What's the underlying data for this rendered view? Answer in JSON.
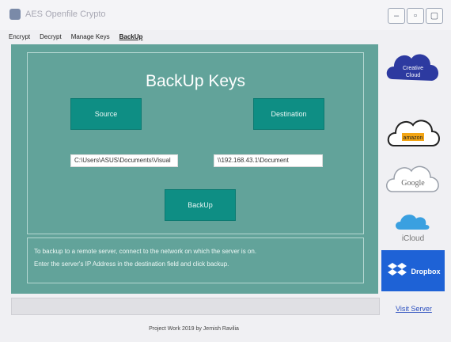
{
  "window": {
    "title": "AES Openfile Crypto"
  },
  "menu": {
    "tabs": [
      {
        "label": "Encrypt"
      },
      {
        "label": "Decrypt"
      },
      {
        "label": "Manage Keys"
      },
      {
        "label": "BackUp"
      }
    ],
    "active_tab": "BackUp"
  },
  "backup": {
    "heading": "BackUp Keys",
    "source_button": "Source",
    "destination_button": "Destination",
    "source_path": "C:\\Users\\ASUS\\Documents\\Visual",
    "destination_path": "\\\\192.168.43.1\\Document",
    "backup_button": "BackUp"
  },
  "info": {
    "line1": "To backup to a remote server, connect to the network on which the server is on.",
    "line2": "Enter the server's IP Address in the destination field and click backup."
  },
  "sidebar": {
    "logos": [
      {
        "label1": "Creative",
        "label2": "Cloud",
        "icon": "creative-cloud-icon"
      },
      {
        "label1": "amazon",
        "icon": "amazon-cloud-icon"
      },
      {
        "label1": "Google",
        "icon": "google-cloud-icon"
      },
      {
        "label1": "iCloud",
        "icon": "icloud-icon"
      },
      {
        "label1": "Dropbox",
        "icon": "dropbox-icon"
      }
    ],
    "visit_link": "Visit Server"
  },
  "footer": {
    "text": "Project Work 2019 by Jemish Ravilia"
  },
  "colors": {
    "panel": "#62a39a",
    "button": "#0e8e84",
    "link": "#2b4fbf"
  }
}
